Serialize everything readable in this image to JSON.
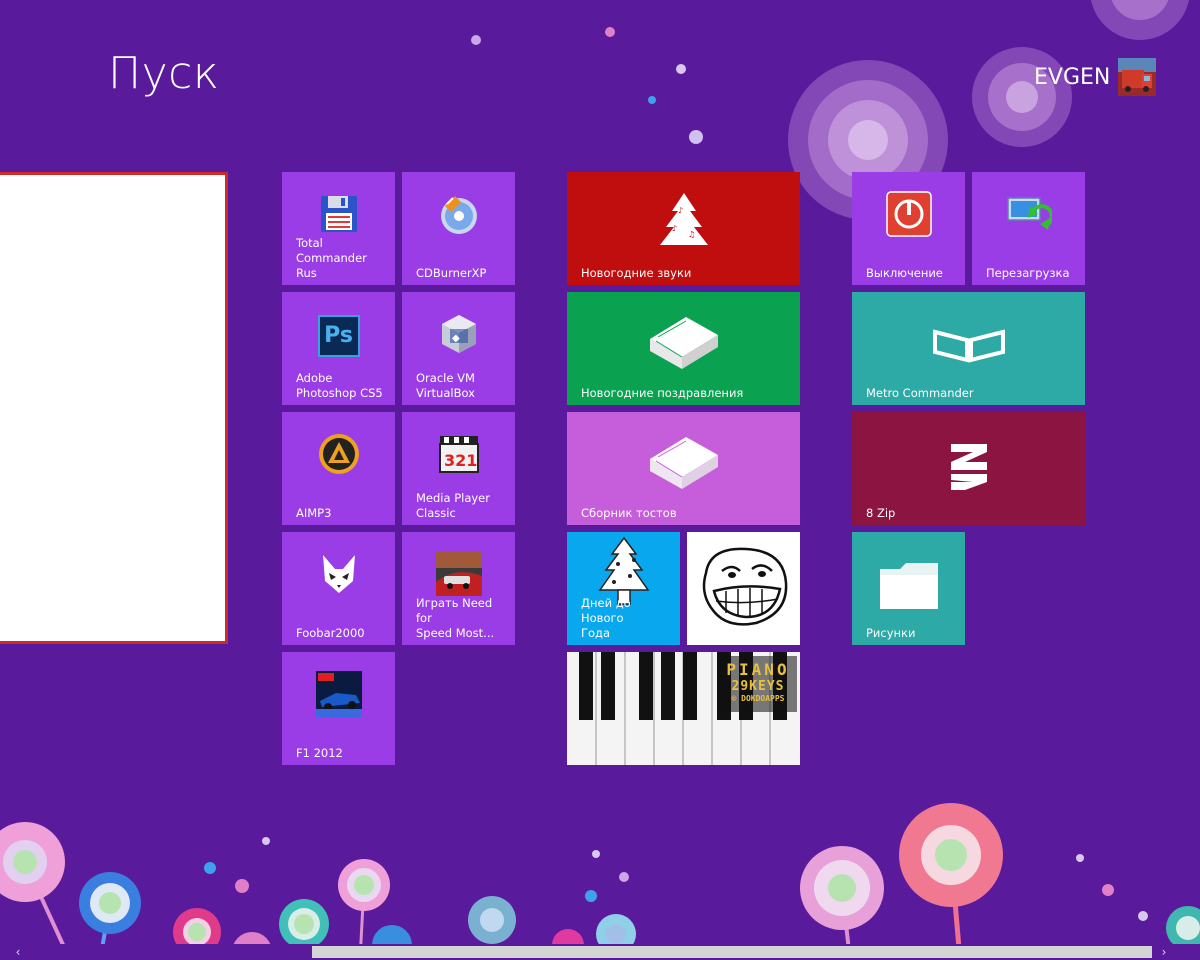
{
  "header": {
    "title": "Пуск",
    "user_name": "EVGEN"
  },
  "tiles": {
    "total_commander": "Total\nCommander Rus",
    "cdburner": "CDBurnerXP",
    "photoshop": "Adobe\nPhotoshop CS5",
    "virtualbox": "Oracle VM\nVirtualBox",
    "aimp": "AIMP3",
    "mpc": "Media Player\nClassic",
    "foobar": "Foobar2000",
    "nfs": "Играть Need for\nSpeed Most...",
    "f1": "F1 2012",
    "sounds": "Новогодние звуки",
    "greetings": "Новогодние поздравления",
    "toasts": "Сборник тостов",
    "days": "Дней до Нового\nГода",
    "piano_line1": "PIANO",
    "piano_line2": "29KEYS",
    "piano_line3": "© DOKDOAPPS",
    "shutdown": "Выключение",
    "restart": "Перезагрузка",
    "metro": "Metro Commander",
    "zip": "8 Zip",
    "pictures": "Рисунки"
  },
  "icon_text": {
    "ps": "Ps",
    "mpc_num": "321"
  },
  "colors": {
    "background": "#5a1a9c",
    "purple_tile": "#9a3de6",
    "red_tile": "#c00d0d",
    "green_tile": "#0aa151",
    "pink_tile": "#c65ddb",
    "teal_tile": "#2da9a6",
    "maroon_tile": "#8c1440",
    "blue_tile": "#09a8ee"
  }
}
